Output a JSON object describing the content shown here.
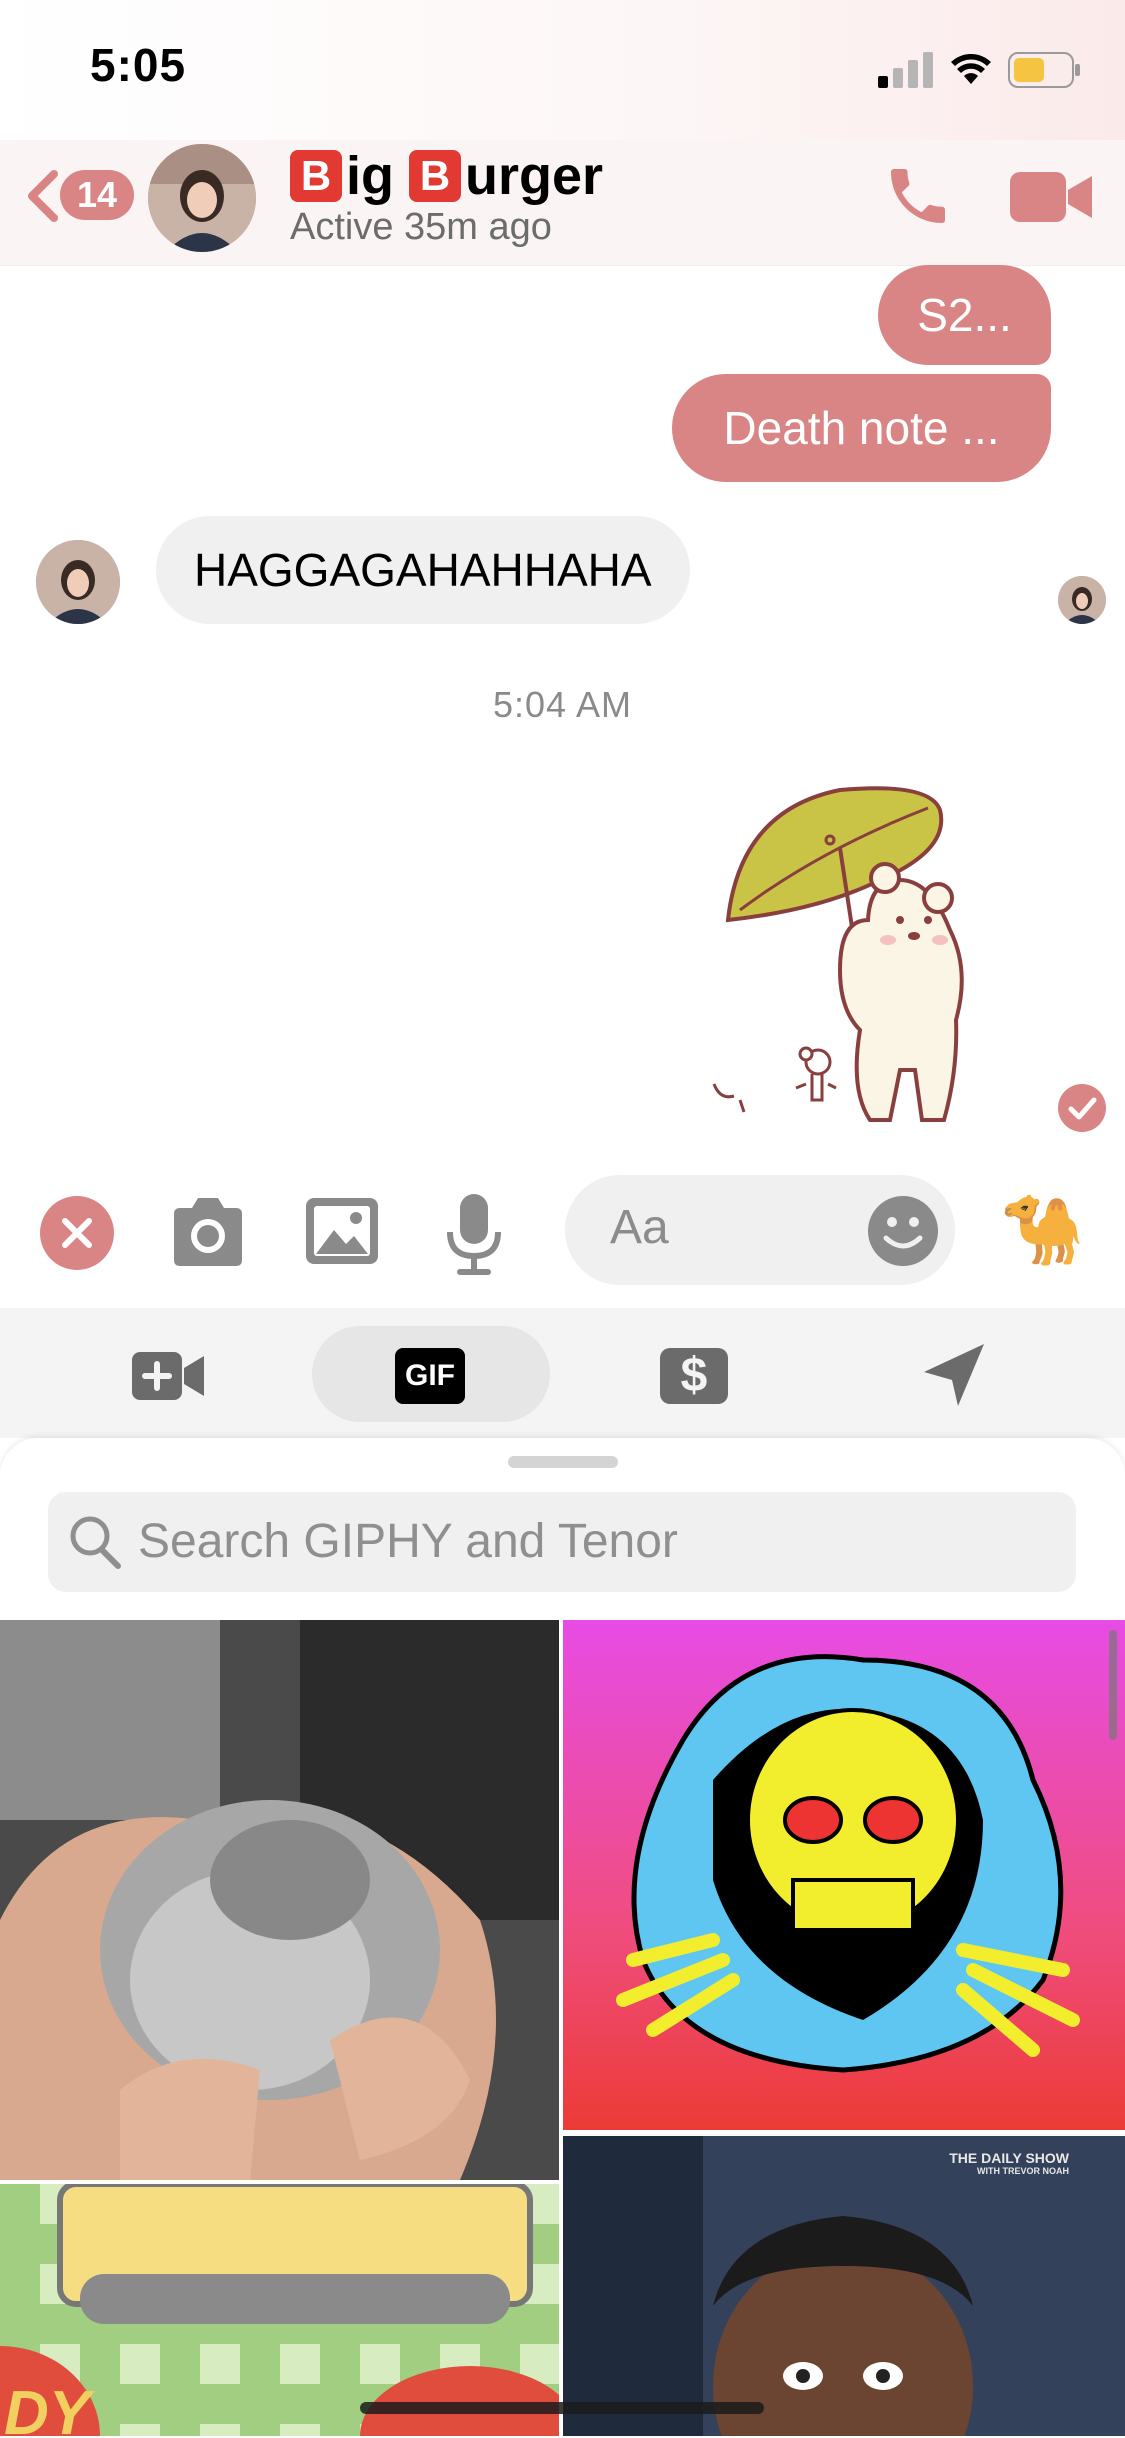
{
  "status": {
    "time": "5:05"
  },
  "header": {
    "unread_count": "14",
    "title_emoji_letter_1": "B",
    "title_part_1": "ig ",
    "title_emoji_letter_2": "B",
    "title_part_2": "urger",
    "subtitle": "Active 35m ago"
  },
  "messages": {
    "out_1": "S2...",
    "out_2": "Death note ...",
    "in_1": "HAGGAGAHAHHAHA",
    "timestamp": "5:04 AM"
  },
  "composer": {
    "placeholder": "Aa",
    "emoji_reaction": "🐪"
  },
  "tray": {
    "tabs": [
      "video-chat",
      "gif",
      "payments",
      "location"
    ],
    "gif_label": "GIF",
    "payment_symbol": "$",
    "selected": "gif"
  },
  "gif_search": {
    "placeholder": "Search GIPHY and Tenor"
  },
  "gif_results": {
    "tile_3_caption": "THE DAILY SHOW",
    "tile_3_caption_sub": "WITH TREVOR NOAH",
    "tile_4_text": "DY"
  },
  "colors": {
    "accent": "#d98585",
    "grey_icon": "#8a8a8a",
    "header_bg": "#fbf4f4"
  }
}
